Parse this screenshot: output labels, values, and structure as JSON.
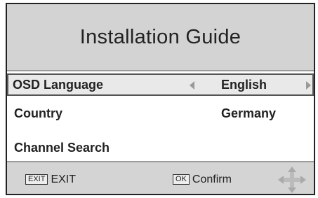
{
  "title": "Installation Guide",
  "rows": [
    {
      "label": "OSD Language",
      "value": "English"
    },
    {
      "label": "Country",
      "value": "Germany"
    },
    {
      "label": "Channel Search",
      "value": ""
    }
  ],
  "footer": {
    "exit_key": "EXIT",
    "exit_label": "EXIT",
    "ok_key": "OK",
    "ok_label": "Confirm"
  },
  "icons": {
    "left": "left-arrow-icon",
    "right": "right-arrow-icon",
    "nav": "navigation-cross-icon"
  }
}
